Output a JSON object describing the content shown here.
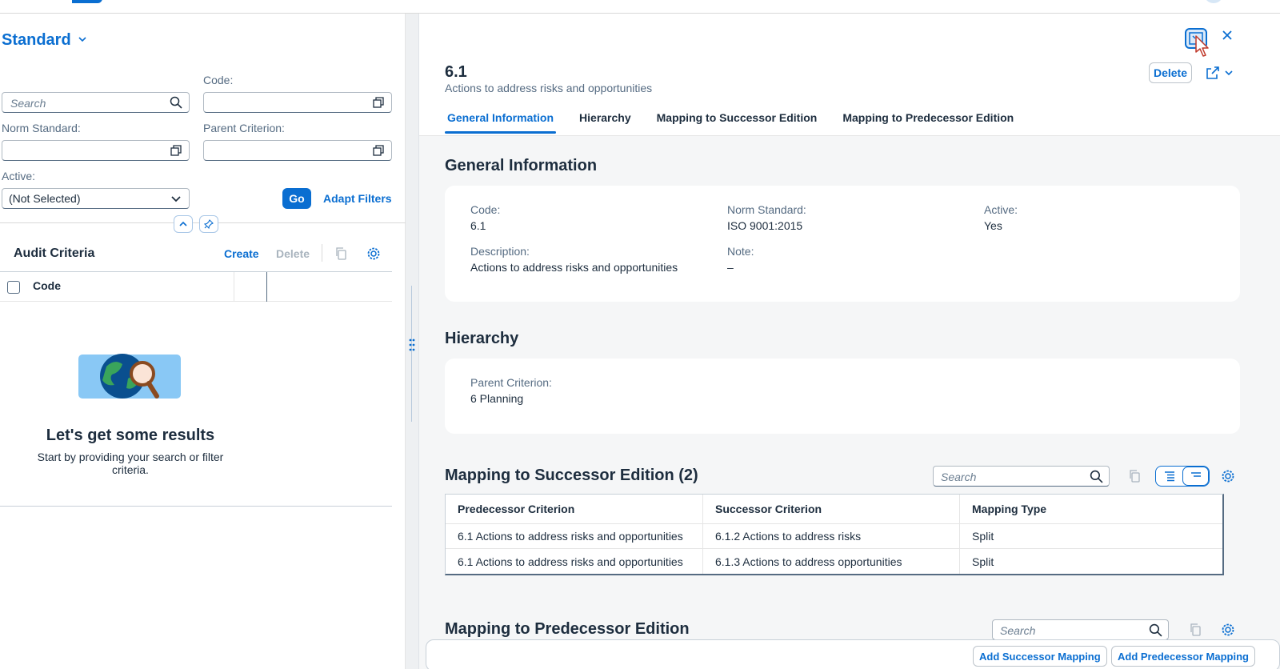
{
  "filter_bar": {
    "variant_name": "Standard",
    "search_placeholder": "Search",
    "code_label": "Code:",
    "norm_standard_label": "Norm Standard:",
    "parent_criterion_label": "Parent Criterion:",
    "active_label": "Active:",
    "active_value": "(Not Selected)",
    "go_label": "Go",
    "adapt_filters_label": "Adapt Filters"
  },
  "list": {
    "title": "Audit Criteria",
    "create_label": "Create",
    "delete_label": "Delete",
    "column_code": "Code",
    "empty_title": "Let's get some results",
    "empty_text": "Start by providing your search or filter criteria."
  },
  "object": {
    "title": "6.1",
    "subtitle": "Actions to address risks and opportunities",
    "delete_label": "Delete",
    "tabs": [
      {
        "label": "General Information",
        "active": true
      },
      {
        "label": "Hierarchy",
        "active": false
      },
      {
        "label": "Mapping to Successor Edition",
        "active": false
      },
      {
        "label": "Mapping to Predecessor Edition",
        "active": false
      }
    ]
  },
  "general": {
    "title": "General Information",
    "code_label": "Code:",
    "code_value": "6.1",
    "norm_label": "Norm Standard:",
    "norm_value": "ISO 9001:2015",
    "active_label": "Active:",
    "active_value": "Yes",
    "description_label": "Description:",
    "description_value": "Actions to address risks and opportunities",
    "note_label": "Note:",
    "note_value": "–"
  },
  "hierarchy": {
    "title": "Hierarchy",
    "parent_label": "Parent Criterion:",
    "parent_value": "6 Planning"
  },
  "successor": {
    "title": "Mapping to Successor Edition (2)",
    "search_placeholder": "Search",
    "columns": [
      "Predecessor Criterion",
      "Successor Criterion",
      "Mapping Type"
    ],
    "rows": [
      [
        "6.1 Actions to address risks and opportunities",
        "6.1.2 Actions to address risks",
        "Split"
      ],
      [
        "6.1 Actions to address risks and opportunities",
        "6.1.3 Actions to address opportunities",
        "Split"
      ]
    ]
  },
  "predecessor": {
    "title": "Mapping to Predecessor Edition",
    "search_placeholder": "Search"
  },
  "footer": {
    "add_successor_label": "Add Successor Mapping",
    "add_predecessor_label": "Add Predecessor Mapping"
  },
  "colors": {
    "brand": "#0a6ed1",
    "text": "#1d2d3e",
    "label": "#556b82"
  }
}
